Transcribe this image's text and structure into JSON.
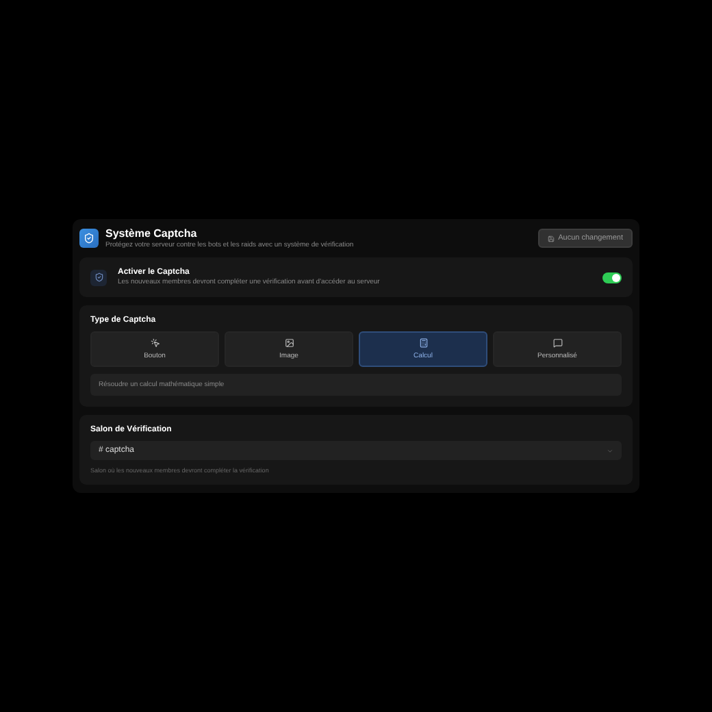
{
  "header": {
    "title": "Système Captcha",
    "subtitle": "Protégez votre serveur contre les bots et les raids avec un système de vérification",
    "save_button": {
      "label": "Aucun changement",
      "disabled": true
    }
  },
  "enable": {
    "title": "Activer le Captcha",
    "description": "Les nouveaux membres devront compléter une vérification avant d'accéder au serveur",
    "on": true
  },
  "captcha_type": {
    "title": "Type de Captcha",
    "options": [
      {
        "kind": "button",
        "label": "Bouton",
        "selected": false
      },
      {
        "kind": "image",
        "label": "Image",
        "selected": false
      },
      {
        "kind": "calc",
        "label": "Calcul",
        "selected": true
      },
      {
        "kind": "custom",
        "label": "Personnalisé",
        "selected": false
      }
    ],
    "description": "Résoudre un calcul mathématique simple"
  },
  "channel": {
    "title": "Salon de Vérification",
    "value": "# captcha",
    "hint": "Salon où les nouveaux membres devront compléter la vérification"
  }
}
